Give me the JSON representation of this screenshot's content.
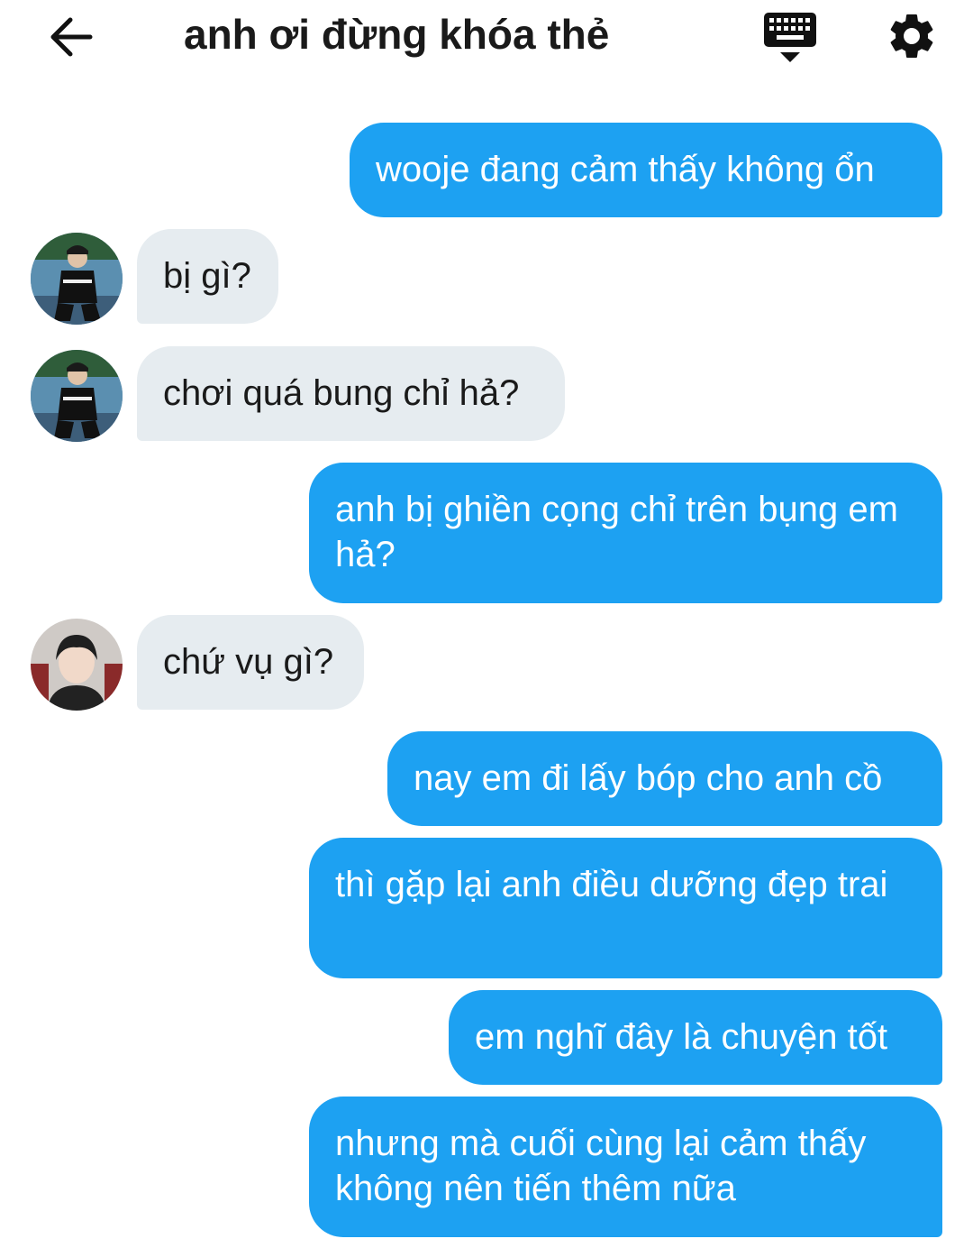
{
  "header": {
    "title": "anh ơi đừng khóa thẻ",
    "back_icon": "arrow-left-icon",
    "keyboard_icon": "keyboard-icon",
    "settings_icon": "gear-icon"
  },
  "messages": [
    {
      "from": "me",
      "text": "wooje đang cảm thấy không ổn"
    },
    {
      "from": "them",
      "avatar": "avatar-boy-court",
      "text": "bị gì?"
    },
    {
      "from": "them",
      "avatar": "avatar-boy-court",
      "text": "chơi quá bung chỉ hả?"
    },
    {
      "from": "me",
      "text": "anh bị ghiền cọng chỉ trên bụng em hả?"
    },
    {
      "from": "them",
      "avatar": "avatar-boy-gaming",
      "text": "chứ vụ gì?"
    },
    {
      "from": "me",
      "text": "nay em đi lấy bóp cho anh cồ"
    },
    {
      "from": "me",
      "text": "thì gặp lại anh điều dưỡng đẹp trai"
    },
    {
      "from": "me",
      "text": "em nghĩ đây là chuyện tốt"
    },
    {
      "from": "me",
      "text": "nhưng mà cuối cùng lại cảm thấy không nên tiến thêm nữa"
    }
  ],
  "colors": {
    "outgoing_bubble": "#1da1f2",
    "incoming_bubble": "#e6ecf0",
    "title_text": "#1a1a1a"
  }
}
